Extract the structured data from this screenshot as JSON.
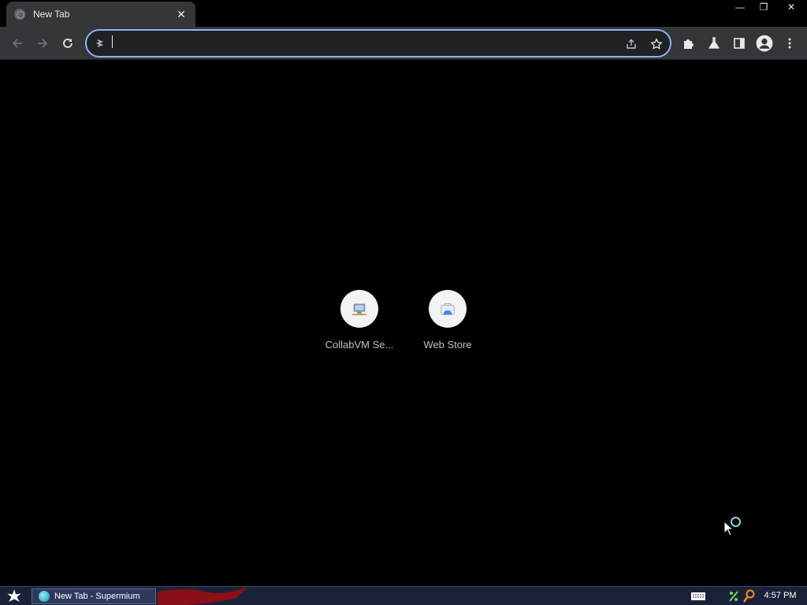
{
  "tab": {
    "title": "New Tab",
    "close_glyph": "✕"
  },
  "window_controls": {
    "minimize": "—",
    "restore": "❐",
    "close": "✕"
  },
  "omnibox": {
    "value": "",
    "placeholder": ""
  },
  "shortcuts": [
    {
      "label": "CollabVM Se...",
      "icon": "collabvm-icon"
    },
    {
      "label": "Web Store",
      "icon": "web-store-icon"
    }
  ],
  "taskbar": {
    "window_label": "New Tab - Supermium",
    "clock": "4:57 PM"
  },
  "colors": {
    "toolbar_bg": "#35363a",
    "omnibox_border": "#8ab4f8",
    "page_bg": "#000000",
    "taskbar_bg": "#1a2238"
  }
}
